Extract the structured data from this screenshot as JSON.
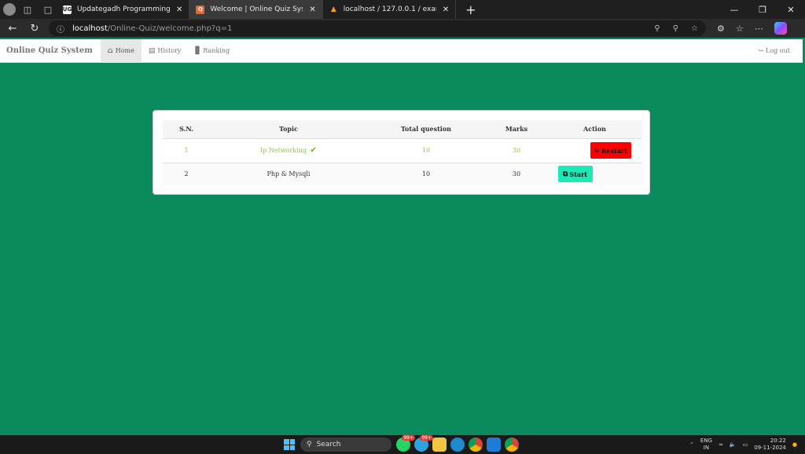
{
  "browser": {
    "tabs": [
      {
        "title": "Updategadh Programming - Upd",
        "favicon": "UG",
        "favicon_color": "#ffffff",
        "active": false
      },
      {
        "title": "Welcome | Online Quiz System",
        "favicon": "Q",
        "favicon_color": "#e8672b",
        "active": true
      },
      {
        "title": "localhost / 127.0.0.1 / exam / use",
        "favicon": "PMA",
        "favicon_color": "#f0a030",
        "active": false
      }
    ],
    "url_host": "localhost",
    "url_path": "/Online-Quiz/welcome.php?q=1"
  },
  "navbar": {
    "brand": "Online Quiz System",
    "links": [
      {
        "label": "Home",
        "icon": "home-icon",
        "active": true
      },
      {
        "label": "History",
        "icon": "list-icon",
        "active": false
      },
      {
        "label": "Ranking",
        "icon": "bar-chart-icon",
        "active": false
      }
    ],
    "logout": "Log out"
  },
  "table": {
    "headers": [
      "S.N.",
      "Topic",
      "Total question",
      "Marks",
      "Action"
    ],
    "rows": [
      {
        "sn": "1",
        "topic": "Ip Networking",
        "total": "10",
        "marks": "30",
        "action": "Restart",
        "completed": true
      },
      {
        "sn": "2",
        "topic": "Php & Mysqli",
        "total": "10",
        "marks": "30",
        "action": "Start",
        "completed": false
      }
    ]
  },
  "taskbar": {
    "search_placeholder": "Search",
    "badges": [
      "99+",
      "99+"
    ],
    "lang_top": "ENG",
    "lang_bottom": "IN",
    "time": "20:22",
    "date": "09-11-2024"
  }
}
